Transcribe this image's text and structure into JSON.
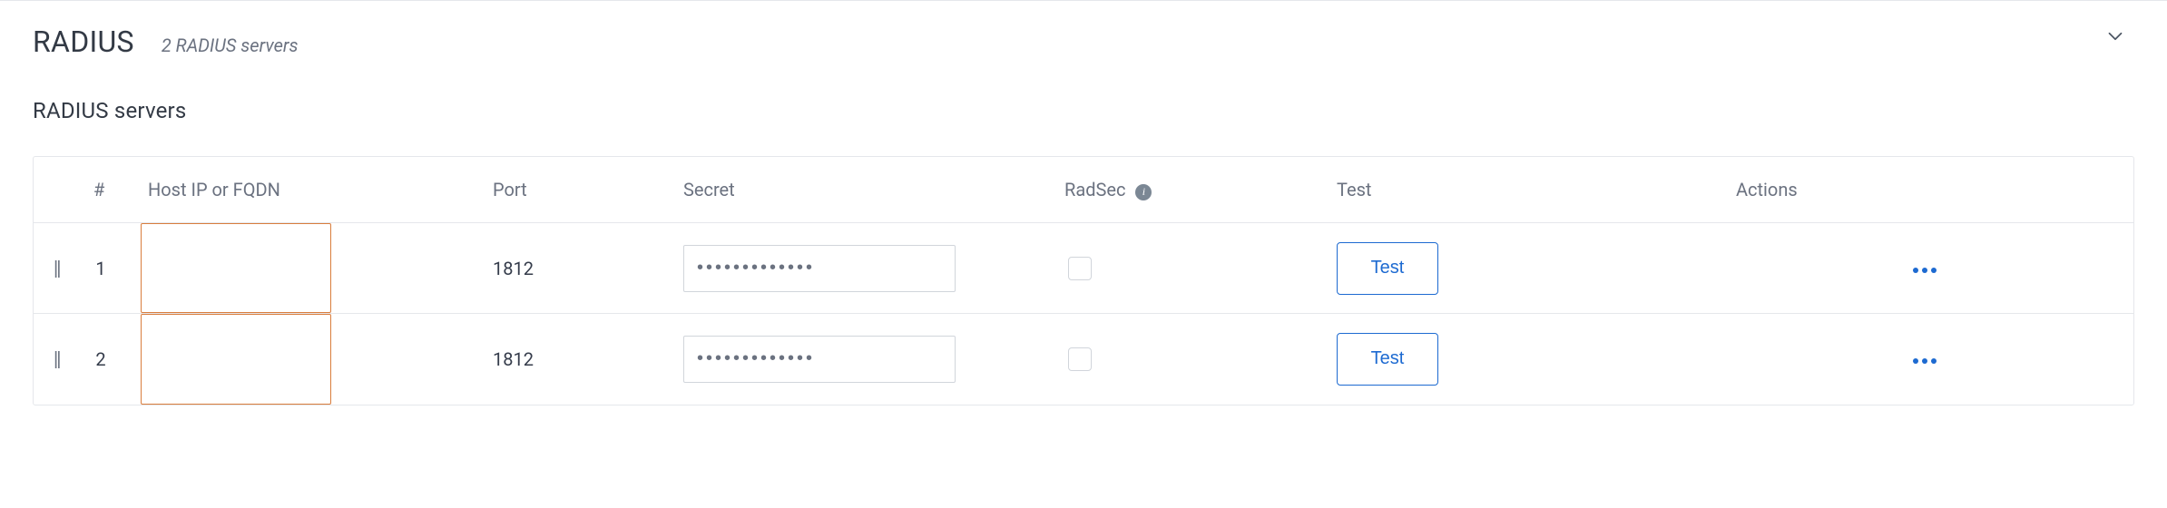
{
  "section": {
    "title": "RADIUS",
    "count_text": "2 RADIUS servers",
    "subheading": "RADIUS servers",
    "collapsed": false
  },
  "columns": {
    "index": "#",
    "host": "Host IP or FQDN",
    "port": "Port",
    "secret": "Secret",
    "radsec": "RadSec",
    "test": "Test",
    "actions": "Actions"
  },
  "buttons": {
    "test": "Test"
  },
  "rows": [
    {
      "index": "1",
      "host": "",
      "port": "1812",
      "secret_mask": "•••••••••••••",
      "secret": "",
      "radsec_checked": false,
      "host_highlighted": true
    },
    {
      "index": "2",
      "host": "",
      "port": "1812",
      "secret_mask": "•••••••••••••",
      "secret": "",
      "radsec_checked": false,
      "host_highlighted": true
    }
  ],
  "colors": {
    "link": "#1d6ad1",
    "outline_warn": "#d97d3d",
    "border": "#e5e7eb",
    "muted": "#6b7280"
  }
}
